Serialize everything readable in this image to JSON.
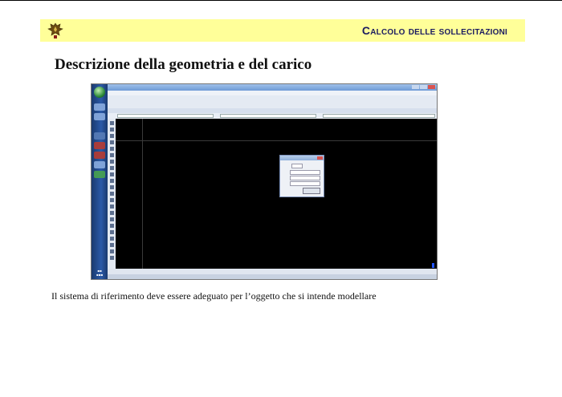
{
  "banner": {
    "title": "Calcolo delle sollecitazioni",
    "logo_icon": "eagle-crest-icon",
    "background_color": "#ffff99",
    "title_color": "#1b1b60"
  },
  "heading": "Descrizione della geometria e del carico",
  "screenshot": {
    "description_icon": "embedded-application-screenshot",
    "canvas_color": "#000000"
  },
  "caption": "Il sistema di riferimento deve essere adeguato per l’oggetto che si intende modellare"
}
